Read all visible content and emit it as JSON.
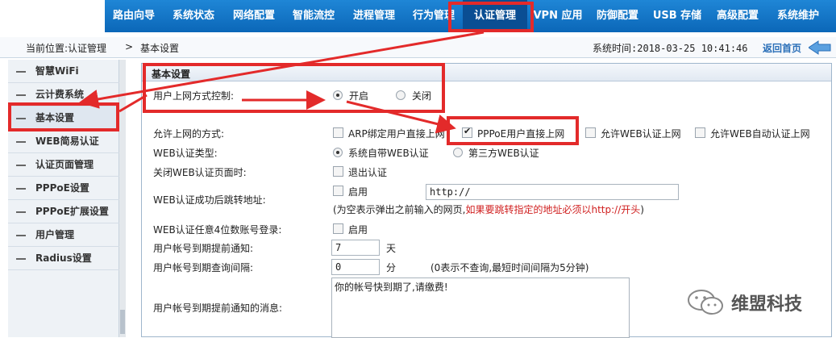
{
  "nav": {
    "items": [
      {
        "label": "路由向导"
      },
      {
        "label": "系统状态"
      },
      {
        "label": "网络配置"
      },
      {
        "label": "智能流控"
      },
      {
        "label": "进程管理"
      },
      {
        "label": "行为管理"
      },
      {
        "label": "认证管理"
      },
      {
        "label": "VPN 应用"
      },
      {
        "label": "防御配置"
      },
      {
        "label": "USB 存储"
      },
      {
        "label": "高级配置"
      },
      {
        "label": "系统维护"
      }
    ],
    "active_index": 6
  },
  "breadcrumb": {
    "location": "当前位置:认证管理",
    "separator": ">",
    "current": "基本设置",
    "system_time": "系统时间:2018-03-25 10:41:46",
    "home_link": "返回首页"
  },
  "sidebar": {
    "items": [
      {
        "label": "智慧WiFi"
      },
      {
        "label": "云计费系统"
      },
      {
        "label": "基本设置"
      },
      {
        "label": "WEB简易认证"
      },
      {
        "label": "认证页面管理"
      },
      {
        "label": "PPPoE设置"
      },
      {
        "label": "PPPoE扩展设置"
      },
      {
        "label": "用户管理"
      },
      {
        "label": "Radius设置"
      }
    ],
    "active_index": 2
  },
  "panel": {
    "title": "基本设置",
    "access_control": {
      "label": "用户上网方式控制:",
      "options": [
        "开启",
        "关闭"
      ],
      "selected": "开启"
    },
    "allowed_methods": {
      "label": "允许上网的方式:",
      "options": [
        {
          "label": "ARP绑定用户直接上网",
          "checked": false
        },
        {
          "label": "PPPoE用户直接上网",
          "checked": true
        },
        {
          "label": "允许WEB认证上网",
          "checked": false
        },
        {
          "label": "允许WEB自动认证上网",
          "checked": false
        }
      ]
    },
    "web_auth_type": {
      "label": "WEB认证类型:",
      "options": [
        "系统自带WEB认证",
        "第三方WEB认证"
      ],
      "selected": "系统自带WEB认证"
    },
    "close_web_auth": {
      "label": "关闭WEB认证页面时:",
      "option": "退出认证",
      "checked": false
    },
    "redirect": {
      "label": "WEB认证成功后跳转地址:",
      "option": "启用",
      "checked": false,
      "url_value": "http://",
      "note_prefix": "(为空表示弹出之前输入的网页,",
      "note_red": "如果要跳转指定的地址必须以http://开头",
      "note_suffix": ")"
    },
    "any4": {
      "label": "WEB认证任意4位数账号登录:",
      "option": "启用",
      "checked": false
    },
    "expire_notice": {
      "label": "用户帐号到期提前通知:",
      "value": "7",
      "unit": "天"
    },
    "query_interval": {
      "label": "用户帐号到期查询间隔:",
      "value": "0",
      "unit": "分",
      "note": "(0表示不查询,最短时间间隔为5分钟)"
    },
    "expire_message": {
      "label": "用户帐号到期提前通知的消息:",
      "value": "你的帐号快到期了,请缴费!"
    }
  },
  "watermark": {
    "text": "维盟科技",
    "icon": "wechat-icon"
  },
  "colors": {
    "nav_bg": "#0b67b8",
    "highlight": "#e32a2a",
    "note_red": "#d02020"
  }
}
